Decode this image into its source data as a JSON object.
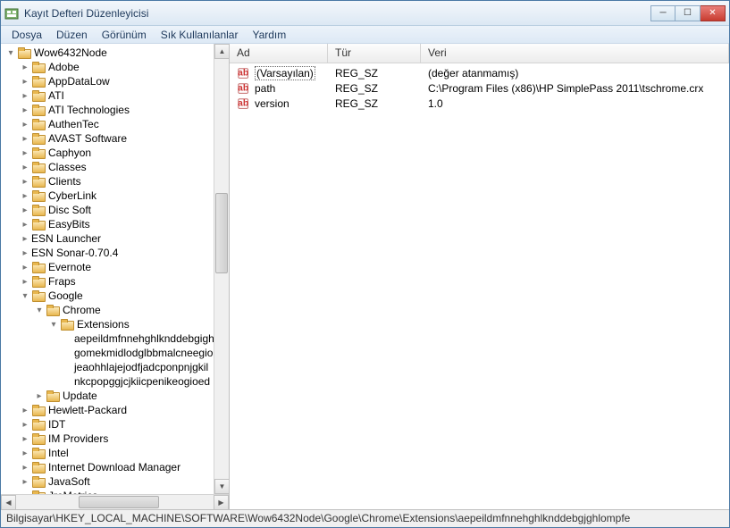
{
  "window": {
    "title": "Kayıt Defteri Düzenleyicisi"
  },
  "menu": {
    "file": "Dosya",
    "edit": "Düzen",
    "view": "Görünüm",
    "favorites": "Sık Kullanılanlar",
    "help": "Yardım"
  },
  "tree": {
    "root": "Wow6432Node",
    "items": [
      "Adobe",
      "AppDataLow",
      "ATI",
      "ATI Technologies",
      "AuthenTec",
      "AVAST Software",
      "Caphyon",
      "Classes",
      "Clients",
      "CyberLink",
      "Disc Soft",
      "EasyBits",
      "ESN Launcher",
      "ESN Sonar-0.70.4",
      "Evernote",
      "Fraps",
      "Google"
    ],
    "google": {
      "chrome": "Chrome",
      "extensions": "Extensions",
      "ext_ids": [
        "aepeildmfnnehghlknddebgigh",
        "gomekmidlodglbbmalcneegio",
        "jeaohhlajejodfjadcponpnjgkil",
        "nkcpopggjcjkiicpenikeogioed"
      ],
      "update": "Update"
    },
    "rest": [
      "Hewlett-Packard",
      "IDT",
      "IM Providers",
      "Intel",
      "Internet Download Manager",
      "JavaSoft",
      "JreMetrics"
    ]
  },
  "columns": {
    "name": "Ad",
    "type": "Tür",
    "data": "Veri"
  },
  "values": [
    {
      "name": "(Varsayılan)",
      "type": "REG_SZ",
      "data": "(değer atanmamış)",
      "default": true
    },
    {
      "name": "path",
      "type": "REG_SZ",
      "data": "C:\\Program Files (x86)\\HP SimplePass 2011\\tschrome.crx",
      "default": false
    },
    {
      "name": "version",
      "type": "REG_SZ",
      "data": "1.0",
      "default": false
    }
  ],
  "status": "Bilgisayar\\HKEY_LOCAL_MACHINE\\SOFTWARE\\Wow6432Node\\Google\\Chrome\\Extensions\\aepeildmfnnehghlknddebgjghlompfe"
}
